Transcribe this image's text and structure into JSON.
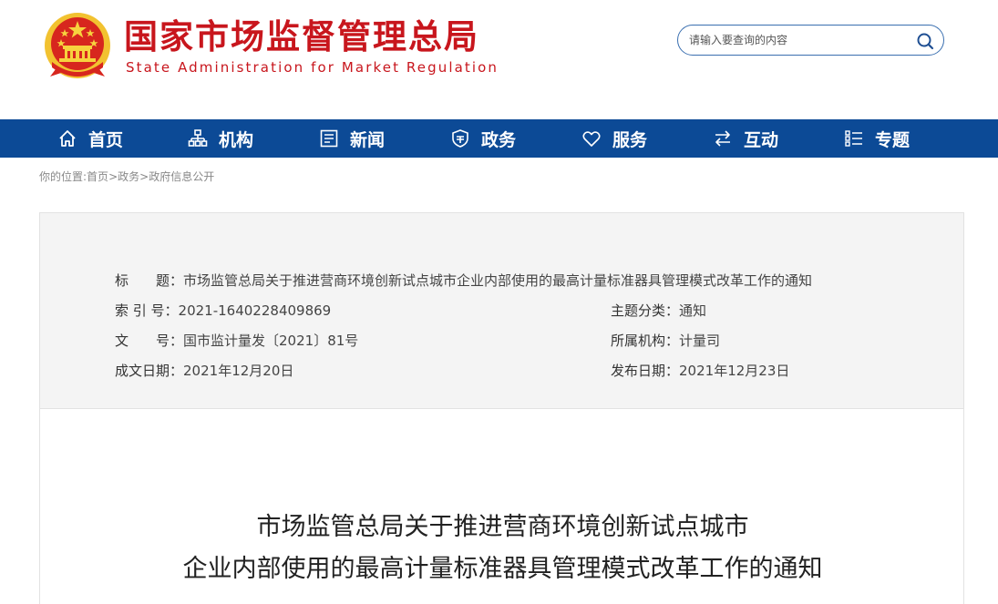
{
  "header": {
    "title": "国家市场监督管理总局",
    "subtitle": "State Administration for Market Regulation",
    "emblem_icon": "national-emblem-icon"
  },
  "search": {
    "placeholder": "请输入要查询的内容",
    "icon": "search-icon"
  },
  "nav": {
    "items": [
      {
        "label": "首页",
        "icon": "home-icon"
      },
      {
        "label": "机构",
        "icon": "org-chart-icon"
      },
      {
        "label": "新闻",
        "icon": "news-icon"
      },
      {
        "label": "政务",
        "icon": "government-icon"
      },
      {
        "label": "服务",
        "icon": "heart-icon"
      },
      {
        "label": "互动",
        "icon": "exchange-icon"
      },
      {
        "label": "专题",
        "icon": "topic-list-icon"
      }
    ]
  },
  "breadcrumb": {
    "prefix": "你的位置:",
    "items": [
      "首页",
      "政务",
      "政府信息公开"
    ],
    "separator": ">"
  },
  "info": {
    "title_label": "标　　题：",
    "title_value": "市场监管总局关于推进营商环境创新试点城市企业内部使用的最高计量标准器具管理模式改革工作的通知",
    "index_label": "索 引 号：",
    "index_value": "2021-1640228409869",
    "category_label": "主题分类：",
    "category_value": "通知",
    "docno_label": "文　　号：",
    "docno_value": "国市监计量发〔2021〕81号",
    "org_label": "所属机构：",
    "org_value": "计量司",
    "created_label": "成文日期：",
    "created_value": "2021年12月20日",
    "published_label": "发布日期：",
    "published_value": "2021年12月23日"
  },
  "article": {
    "title_line1": "市场监管总局关于推进营商环境创新试点城市",
    "title_line2": "企业内部使用的最高计量标准器具管理模式改革工作的通知"
  },
  "colors": {
    "brand_red": "#c8161d",
    "nav_blue": "#0c4a96",
    "emblem_gold": "#f2c230"
  }
}
